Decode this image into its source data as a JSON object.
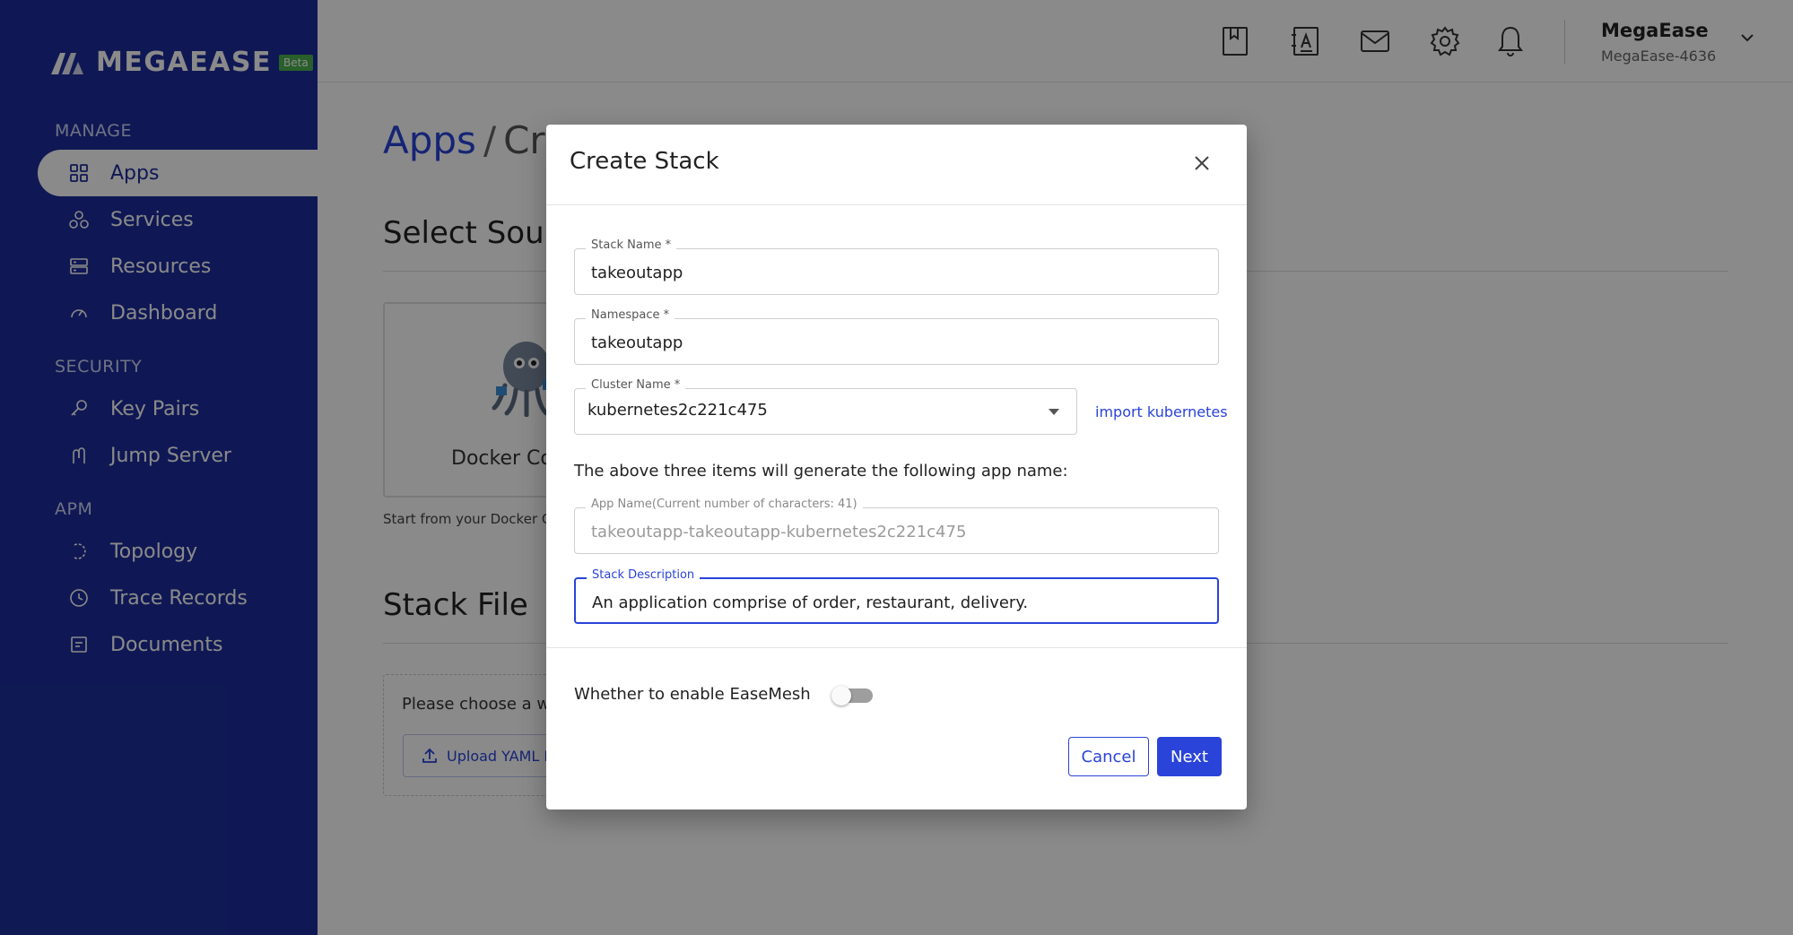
{
  "brand": {
    "name": "MEGAEASE",
    "badge": "Beta"
  },
  "sidebar": {
    "sections": [
      {
        "title": "MANAGE",
        "items": [
          {
            "label": "Apps",
            "icon": "grid-icon",
            "active": true
          },
          {
            "label": "Services",
            "icon": "services-icon"
          },
          {
            "label": "Resources",
            "icon": "server-icon"
          },
          {
            "label": "Dashboard",
            "icon": "gauge-icon"
          }
        ]
      },
      {
        "title": "SECURITY",
        "items": [
          {
            "label": "Key Pairs",
            "icon": "key-icon"
          },
          {
            "label": "Jump Server",
            "icon": "jump-icon"
          }
        ]
      },
      {
        "title": "APM",
        "items": [
          {
            "label": "Topology",
            "icon": "topology-icon"
          },
          {
            "label": "Trace Records",
            "icon": "clock-icon"
          },
          {
            "label": "Documents",
            "icon": "document-icon"
          }
        ]
      }
    ]
  },
  "header": {
    "icons": [
      "bookmark-icon",
      "contacts-icon",
      "mail-icon",
      "gear-icon",
      "bell-icon"
    ],
    "user": {
      "name": "MegaEase",
      "org": "MegaEase-4636"
    }
  },
  "page": {
    "breadcrumb": {
      "root": "Apps",
      "separator": "/",
      "current": "Cr"
    },
    "select_source_title": "Select Sourc",
    "source_card_label": "Docker Co",
    "source_hint": "Start from your Docker Co",
    "stack_file_title": "Stack File",
    "choose_text": "Please choose a way",
    "upload_label": "Upload YAML Fi"
  },
  "modal": {
    "title": "Create Stack",
    "stack_name": {
      "label": "Stack Name *",
      "value": "takeoutapp"
    },
    "namespace": {
      "label": "Namespace *",
      "value": "takeoutapp"
    },
    "cluster": {
      "label": "Cluster Name *",
      "value": "kubernetes2c221c475",
      "import_label": "import kubernetes"
    },
    "generate_note": "The above three items will generate the following app name:",
    "app_name": {
      "label": "App Name(Current number of characters: 41)",
      "value": "takeoutapp-takeoutapp-kubernetes2c221c475"
    },
    "description": {
      "label": "Stack Description",
      "value": "An application comprise of order, restaurant, delivery."
    },
    "easemesh_label": "Whether to enable EaseMesh",
    "easemesh_enabled": false,
    "cancel_label": "Cancel",
    "next_label": "Next"
  },
  "colors": {
    "sidebar": "#1c2e9b",
    "accent": "#2a43d9",
    "badge": "#4caf50"
  }
}
